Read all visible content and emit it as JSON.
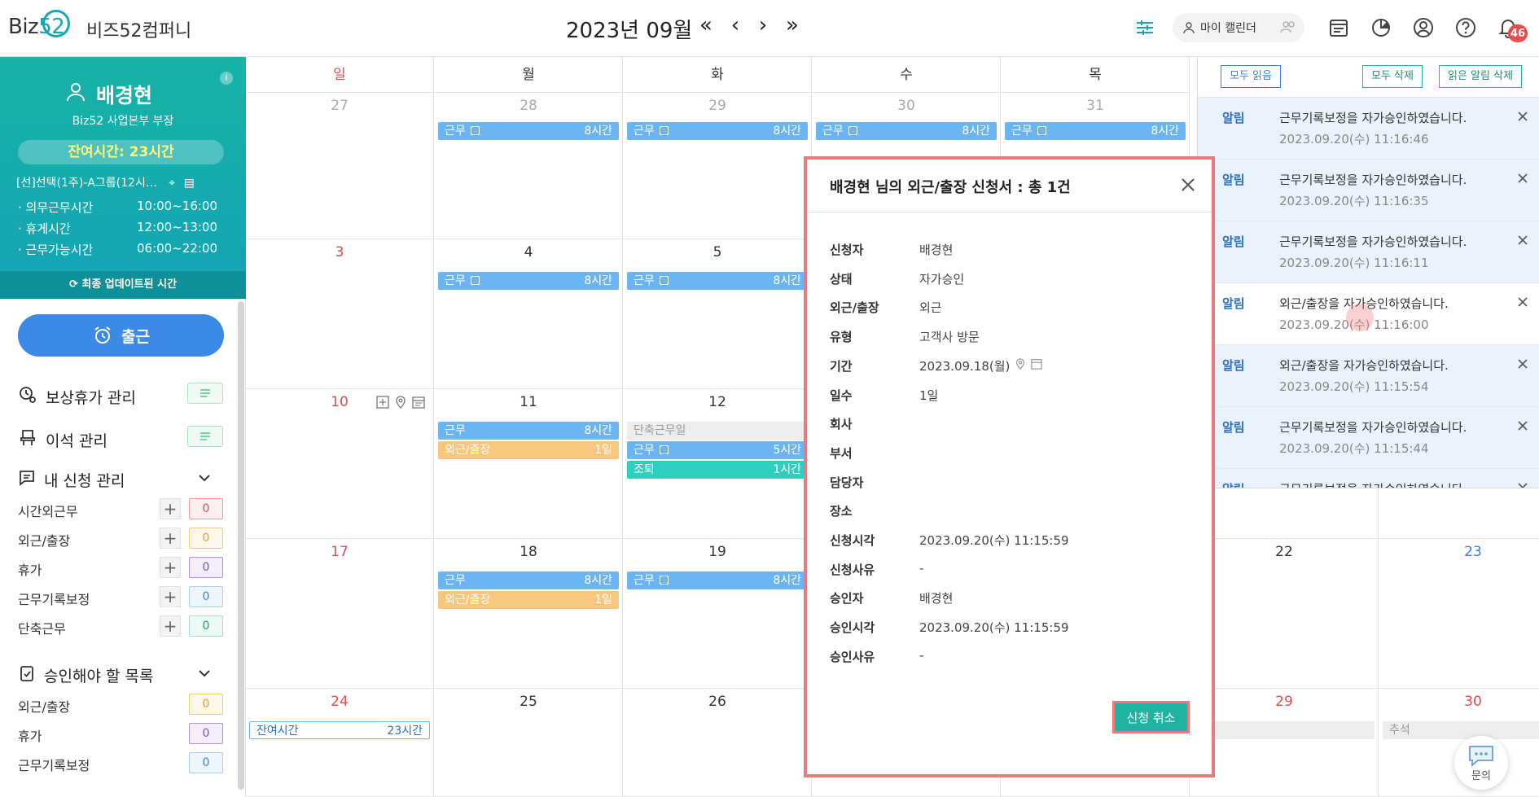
{
  "brand": {
    "logo_prefix": "Biz",
    "logo_num": "52",
    "company": "비즈52컴퍼니"
  },
  "header": {
    "month": "2023년 09월",
    "nav": {
      "prev_year": "«",
      "prev": "‹",
      "next": "›",
      "next_year": "»"
    },
    "my_calendar": "마이 캘린더",
    "notification_count": "46"
  },
  "profile": {
    "name": "배경현",
    "role": "Biz52 사업본부 부장",
    "remaining": "잔여시간: 23시간",
    "group": "[선]선택(1주)-A그룹(12시…",
    "schedule": [
      {
        "label": "· 의무근무시간",
        "value": "10:00~16:00"
      },
      {
        "label": "· 휴게시간",
        "value": "12:00~13:00"
      },
      {
        "label": "· 근무가능시간",
        "value": "06:00~22:00"
      }
    ],
    "updated": "최종 업데이트된 시간",
    "checkin": "출근"
  },
  "menu": {
    "comp_leave": "보상휴가 관리",
    "seat": "이석 관리",
    "my_requests": "내 신청 관리",
    "requests": [
      {
        "label": "시간외근무",
        "count": "0",
        "color": "#f29a9a",
        "bg": "#fdf0f0",
        "text": "#e04b4b"
      },
      {
        "label": "외근/출장",
        "count": "0",
        "color": "#f4c97f",
        "bg": "#fdf6ea",
        "text": "#e0a13c"
      },
      {
        "label": "휴가",
        "count": "0",
        "color": "#b08fe0",
        "bg": "#f4eefc",
        "text": "#7a4fc2"
      },
      {
        "label": "근무기록보정",
        "count": "0",
        "color": "#a8cff2",
        "bg": "#eef6fd",
        "text": "#3c7ee0"
      },
      {
        "label": "단축근무",
        "count": "0",
        "color": "#9ee0c8",
        "bg": "#edfaf4",
        "text": "#1a9f7a"
      }
    ],
    "to_approve": "승인해야 할 목록",
    "approvals": [
      {
        "label": "외근/출장",
        "count": "0",
        "color": "#f4c97f",
        "bg": "#fdf6ea",
        "text": "#e0a13c"
      },
      {
        "label": "휴가",
        "count": "0",
        "color": "#b08fe0",
        "bg": "#f4eefc",
        "text": "#7a4fc2"
      },
      {
        "label": "근무기록보정",
        "count": "0",
        "color": "#a8cff2",
        "bg": "#eef6fd",
        "text": "#3c7ee0"
      }
    ]
  },
  "calendar": {
    "weekdays": [
      "일",
      "월",
      "화",
      "수",
      "목"
    ],
    "weeks": [
      [
        "27",
        "28",
        "29",
        "30",
        "31"
      ],
      [
        "3",
        "4",
        "5",
        "",
        ""
      ],
      [
        "10",
        "11",
        "12",
        "",
        ""
      ],
      [
        "17",
        "18",
        "19",
        "",
        ""
      ],
      [
        "24",
        "25",
        "26",
        "",
        ""
      ]
    ],
    "right_dates": {
      "d22": "22",
      "d23": "23",
      "d29": "29",
      "d30": "30"
    },
    "events": {
      "work": "근무",
      "hours8": "8시간",
      "hours5": "5시간",
      "trip": "외근/출장",
      "day1": "1일",
      "short_day": "단축근무일",
      "early_leave": "조퇴",
      "hour1": "1시간",
      "remaining": "잔여시간",
      "remaining_val": "23시간",
      "chuseok": "추석"
    }
  },
  "modal": {
    "title": "배경현 님의 외근/출장 신청서 : 총 1건",
    "rows": [
      {
        "label": "신청자",
        "value": "배경현"
      },
      {
        "label": "상태",
        "value": "자가승인"
      },
      {
        "label": "외근/출장",
        "value": "외근"
      },
      {
        "label": "유형",
        "value": "고객사 방문"
      },
      {
        "label": "기간",
        "value": "2023.09.18(월)"
      },
      {
        "label": "일수",
        "value": "1일"
      },
      {
        "label": "회사",
        "value": ""
      },
      {
        "label": "부서",
        "value": ""
      },
      {
        "label": "담당자",
        "value": ""
      },
      {
        "label": "장소",
        "value": ""
      },
      {
        "label": "신청시각",
        "value": "2023.09.20(수) 11:15:59"
      },
      {
        "label": "신청사유",
        "value": "-"
      },
      {
        "label": "승인자",
        "value": "배경현"
      },
      {
        "label": "승인시각",
        "value": "2023.09.20(수) 11:15:59"
      },
      {
        "label": "승인사유",
        "value": "-"
      }
    ],
    "cancel": "신청 취소"
  },
  "notifications": {
    "read_all": "모두 읽음",
    "delete_all": "모두 삭제",
    "delete_read": "읽은 알림 삭제",
    "items": [
      {
        "tag": "알림",
        "msg": "근무기록보정을 자가승인하였습니다.",
        "time": "2023.09.20(수) 11:16:46",
        "unread": true
      },
      {
        "tag": "알림",
        "msg": "근무기록보정을 자가승인하였습니다.",
        "time": "2023.09.20(수) 11:16:35",
        "unread": true
      },
      {
        "tag": "알림",
        "msg": "근무기록보정을 자가승인하였습니다.",
        "time": "2023.09.20(수) 11:16:11",
        "unread": true
      },
      {
        "tag": "알림",
        "msg": "외근/출장을 자가승인하였습니다.",
        "time": "2023.09.20(수) 11:16:00",
        "unread": false
      },
      {
        "tag": "알림",
        "msg": "외근/출장을 자가승인하였습니다.",
        "time": "2023.09.20(수) 11:15:54",
        "unread": true
      },
      {
        "tag": "알림",
        "msg": "근무기록보정을 자가승인하였습니다.",
        "time": "2023.09.20(수) 11:15:44",
        "unread": true
      },
      {
        "tag": "알림",
        "msg": "근무기록보정을 자가승인하였습니다.",
        "time": "",
        "unread": true
      }
    ]
  },
  "chat": {
    "label": "문의"
  },
  "colors": {
    "accent": "#17a6b8",
    "work": "#6bb5f3",
    "trip": "#f7c77d",
    "early": "#2fcfbf",
    "modal_border": "#e97a7e",
    "checkin": "#3c8ae6"
  }
}
